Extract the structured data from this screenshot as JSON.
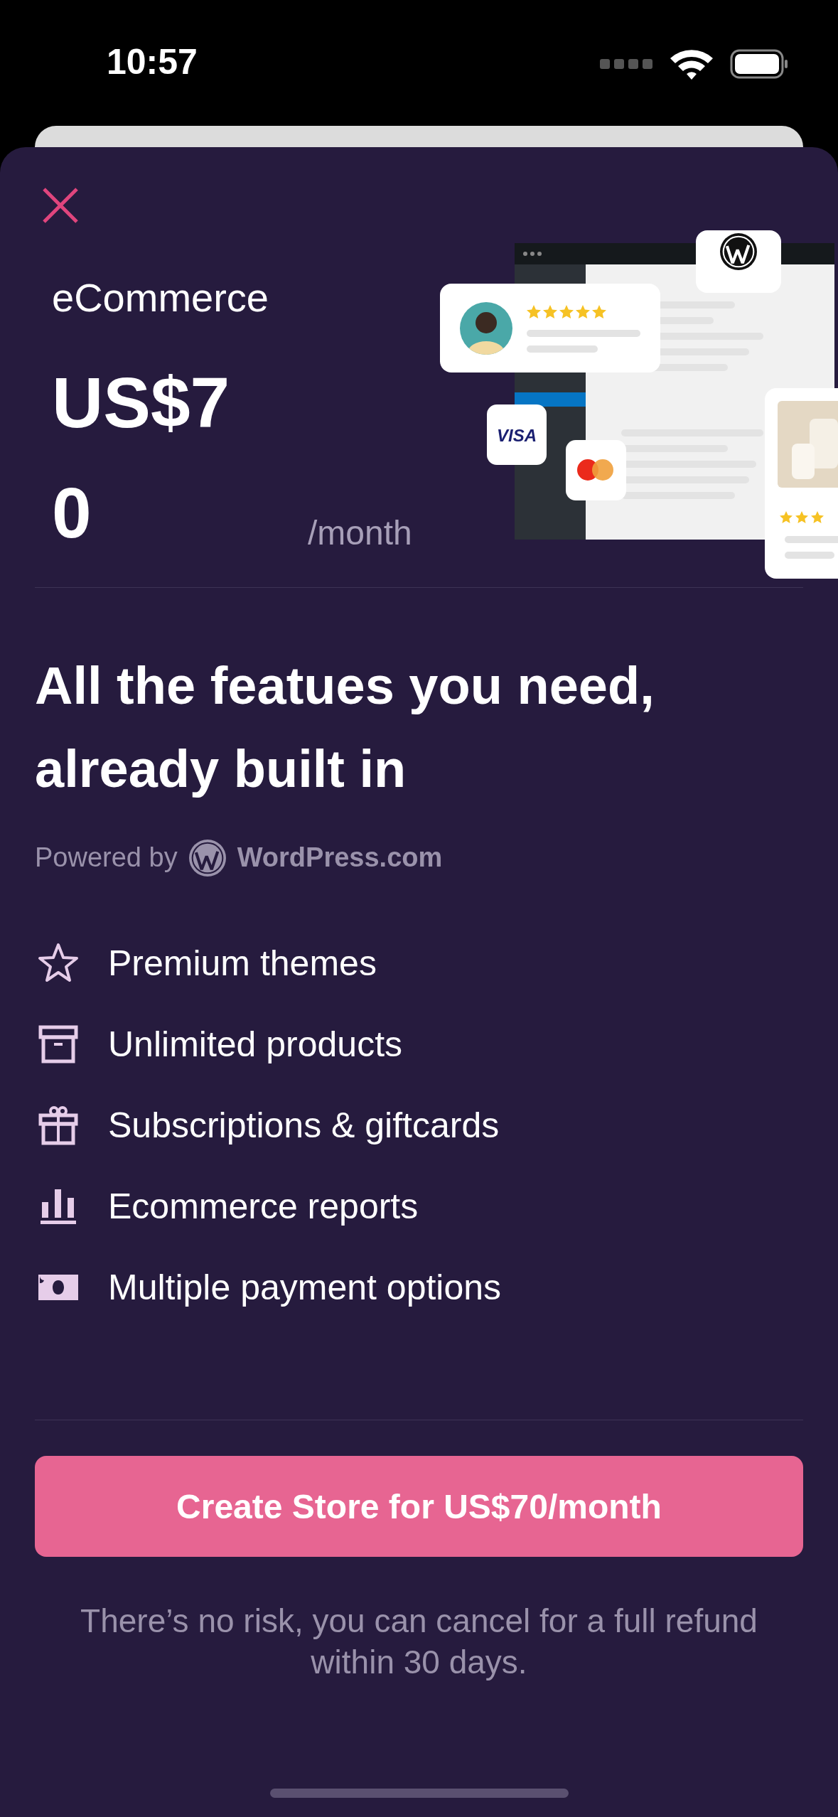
{
  "status_bar": {
    "time": "10:57"
  },
  "plan": {
    "name": "eCommerce",
    "price": "US$70",
    "period": "/month"
  },
  "illustration": {
    "payment_logo": "VISA"
  },
  "headline": "All the featues you need, already built in",
  "powered_by": {
    "label": "Powered by",
    "brand": "WordPress.com"
  },
  "features": [
    {
      "label": "Premium themes"
    },
    {
      "label": "Unlimited products"
    },
    {
      "label": "Subscriptions & giftcards"
    },
    {
      "label": "Ecommerce reports"
    },
    {
      "label": "Multiple payment options"
    }
  ],
  "cta": {
    "label": "Create Store for US$70/month"
  },
  "note": "There’s no risk, you can cancel for a full refund within 30 days."
}
